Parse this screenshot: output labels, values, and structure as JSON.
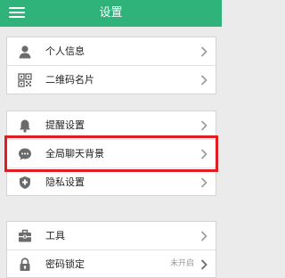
{
  "header": {
    "title": "设置",
    "menu_icon": "menu-icon"
  },
  "groups": [
    {
      "items": [
        {
          "label": "个人信息",
          "icon": "person-icon",
          "chevron": true
        },
        {
          "label": "二维码名片",
          "icon": "qrcode-icon",
          "chevron": true
        }
      ]
    },
    {
      "items": [
        {
          "label": "提醒设置",
          "icon": "bell-icon",
          "chevron": true
        },
        {
          "label": "全局聊天背景",
          "icon": "chat-bubble-icon",
          "chevron": true,
          "highlighted": true
        },
        {
          "label": "隐私设置",
          "icon": "shield-icon",
          "chevron": true
        }
      ]
    },
    {
      "items": [
        {
          "label": "工具",
          "icon": "toolbox-icon",
          "chevron": true
        },
        {
          "label": "密码锁定",
          "icon": "lock-icon",
          "chevron": true,
          "status": "未开启"
        }
      ]
    }
  ],
  "colors": {
    "header_bg": "#2fb37a",
    "icon_color": "#6b6b6b",
    "highlight_border": "#e01d23",
    "page_bg": "#ebebeb"
  }
}
